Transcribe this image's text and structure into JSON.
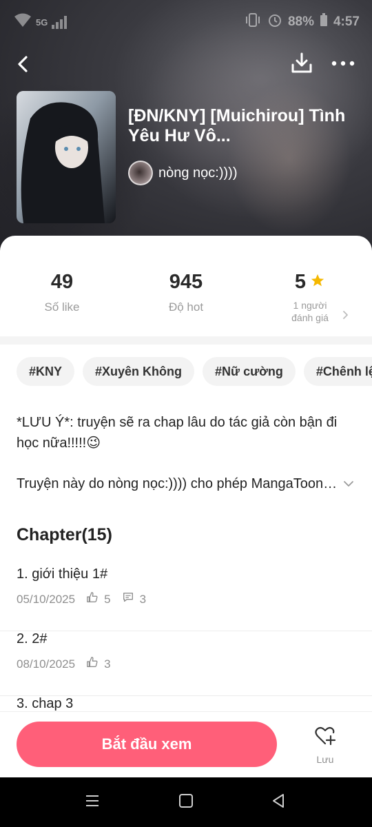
{
  "status_bar": {
    "network": "5G",
    "battery": "88%",
    "time": "4:57"
  },
  "story": {
    "title": "[ĐN/KNY] [Muichirou] Tình Yêu Hư Vô...",
    "author": "nòng nọc:))))"
  },
  "stats": {
    "likes": {
      "value": "49",
      "label": "Số like"
    },
    "hot": {
      "value": "945",
      "label": "Độ hot"
    },
    "rating": {
      "value": "5",
      "label_line1": "1 người",
      "label_line2": "đánh giá"
    }
  },
  "tags": [
    "#KNY",
    "#Xuyên Không",
    "#Nữ cường",
    "#Chênh lệch"
  ],
  "description": {
    "line1": "*LƯU Ý*: truyện sẽ ra chap lâu do tác giả còn bận đi học nữa!!!!!😉",
    "line2": "Truyện này do nòng nọc:)))) cho phép MangaToon đăng tải"
  },
  "chapters_header": "Chapter(15)",
  "chapters": [
    {
      "title": "1. giới thiệu 1#",
      "date": "05/10/2025",
      "likes": "5",
      "comments": "3"
    },
    {
      "title": "2. 2#",
      "date": "08/10/2025",
      "likes": "3"
    },
    {
      "title": "3. chap 3"
    }
  ],
  "actions": {
    "start_label": "Bắt đầu xem",
    "save_label": "Lưu"
  },
  "colors": {
    "accent": "#ff5f79",
    "star": "#f5b800"
  },
  "icons": [
    "back-icon",
    "download-icon",
    "more-icon",
    "star-icon",
    "chevron-right-icon",
    "chevron-down-icon",
    "thumbs-up-icon",
    "comment-icon",
    "heart-plus-icon"
  ]
}
